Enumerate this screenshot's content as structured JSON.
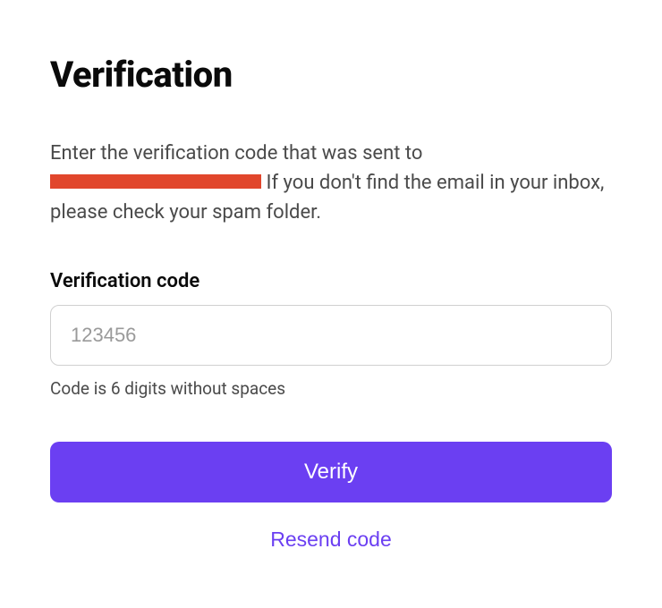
{
  "title": "Verification",
  "description": {
    "part1": "Enter the verification code that was sent to ",
    "part2": " If you don't find the email in your inbox, please check your spam folder."
  },
  "field": {
    "label": "Verification code",
    "placeholder": "123456",
    "value": "",
    "helper": "Code is 6 digits without spaces"
  },
  "actions": {
    "verify_label": "Verify",
    "resend_label": "Resend code"
  }
}
